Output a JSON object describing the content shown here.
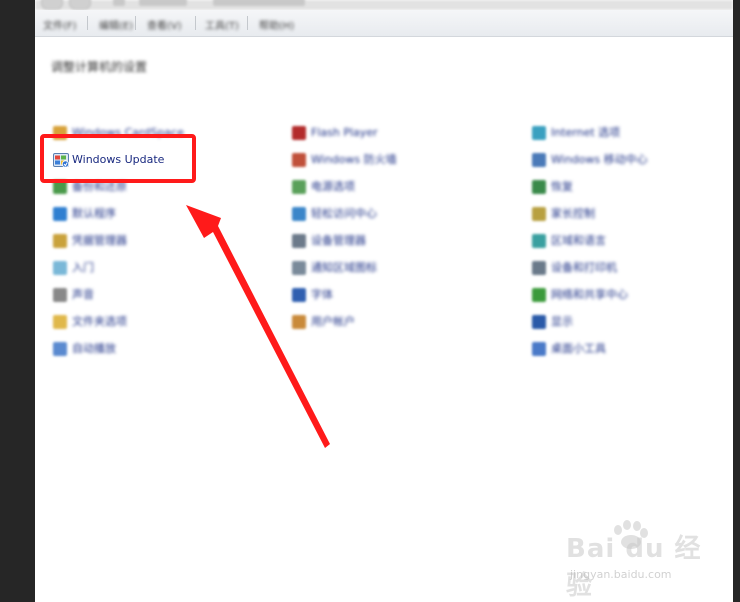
{
  "menubar": {
    "items": [
      "文件(F)",
      "编辑(E)",
      "查看(V)",
      "工具(T)",
      "帮助(H)"
    ]
  },
  "heading": "调整计算机的设置",
  "control_panel": {
    "columns": [
      {
        "items": [
          {
            "label": "Windows CardSpace",
            "icon": "cardspace-icon",
            "color": "#d8a23a"
          },
          {
            "label": "Windows Update",
            "icon": "windows-update-icon",
            "color": "#3c78c8"
          },
          {
            "label": "备份和还原",
            "icon": "backup-icon",
            "color": "#4a9a4a"
          },
          {
            "label": "默认程序",
            "icon": "default-programs-icon",
            "color": "#2f7fd1"
          },
          {
            "label": "凭据管理器",
            "icon": "credential-icon",
            "color": "#c9a23c"
          },
          {
            "label": "入门",
            "icon": "getting-started-icon",
            "color": "#7ab8d8"
          },
          {
            "label": "声音",
            "icon": "sound-icon",
            "color": "#888888"
          },
          {
            "label": "文件夹选项",
            "icon": "folder-options-icon",
            "color": "#e0b84a"
          },
          {
            "label": "自动播放",
            "icon": "autoplay-icon",
            "color": "#5a8ad0"
          }
        ]
      },
      {
        "items": [
          {
            "label": "Flash Player",
            "icon": "flash-icon",
            "color": "#b32b2b"
          },
          {
            "label": "Windows 防火墙",
            "icon": "firewall-icon",
            "color": "#c0503a"
          },
          {
            "label": "电源选项",
            "icon": "power-icon",
            "color": "#5aa05a"
          },
          {
            "label": "轻松访问中心",
            "icon": "ease-of-access-icon",
            "color": "#3b86c9"
          },
          {
            "label": "设备管理器",
            "icon": "device-manager-icon",
            "color": "#6c7a8a"
          },
          {
            "label": "通知区域图标",
            "icon": "notification-icon",
            "color": "#7a8a9a"
          },
          {
            "label": "字体",
            "icon": "fonts-icon",
            "color": "#2f5fb0"
          },
          {
            "label": "用户帐户",
            "icon": "user-accounts-icon",
            "color": "#c98a3a"
          }
        ]
      },
      {
        "items": [
          {
            "label": "Internet 选项",
            "icon": "internet-options-icon",
            "color": "#3aa0c0"
          },
          {
            "label": "Windows 移动中心",
            "icon": "mobility-center-icon",
            "color": "#4a7ab8"
          },
          {
            "label": "恢复",
            "icon": "recovery-icon",
            "color": "#3a8a4a"
          },
          {
            "label": "家长控制",
            "icon": "parental-controls-icon",
            "color": "#b8a040"
          },
          {
            "label": "区域和语言",
            "icon": "region-icon",
            "color": "#3aa0a0"
          },
          {
            "label": "设备和打印机",
            "icon": "devices-printers-icon",
            "color": "#6a7a8a"
          },
          {
            "label": "网络和共享中心",
            "icon": "network-icon",
            "color": "#3a9a3a"
          },
          {
            "label": "显示",
            "icon": "display-icon",
            "color": "#2a5aa8"
          },
          {
            "label": "桌面小工具",
            "icon": "gadgets-icon",
            "color": "#4a7ac8"
          }
        ]
      }
    ]
  },
  "annotation": {
    "highlight_color": "#ff1a1a",
    "arrow_color": "#ff1a1a"
  },
  "watermark": {
    "logo": "Bai du 经验",
    "sub": "jingyan.baidu.com"
  }
}
